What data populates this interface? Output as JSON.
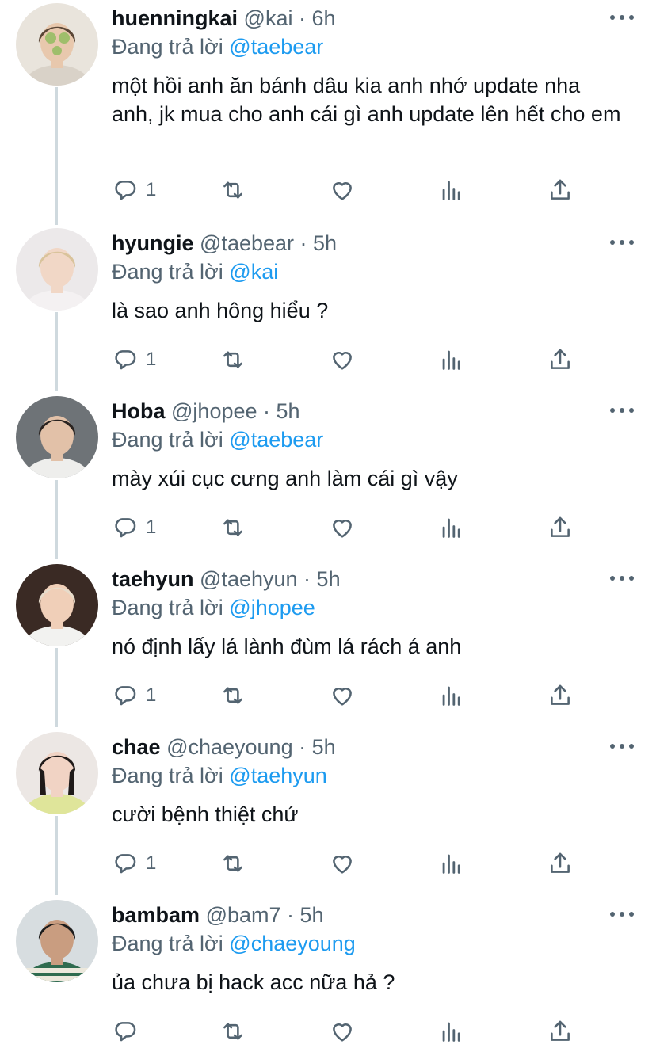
{
  "thread": {
    "tweets": [
      {
        "name": "huenningkai",
        "handle": "@kai",
        "time": "6h",
        "reply_prefix": "Đang trả lời",
        "reply_to": "@taebear",
        "text": "một hồi anh ăn bánh dâu kia anh nhớ update nha anh, jk mua cho anh cái gì anh update lên hết cho em",
        "reply_count": "1",
        "avatar_colors": {
          "bg": "#e9e4dc",
          "hair": "#5a4636",
          "skin": "#e8c8ad",
          "shirt": "#d9d2c8",
          "accent": "#9fbe6b"
        }
      },
      {
        "name": "hyungie",
        "handle": "@taebear",
        "time": "5h",
        "reply_prefix": "Đang trả lời",
        "reply_to": "@kai",
        "text": "là sao anh hông hiểu ?",
        "reply_count": "1",
        "avatar_colors": {
          "bg": "#ece9ea",
          "hair": "#d9c39b",
          "skin": "#f1d7c6",
          "shirt": "#f4f1f2",
          "accent": "#b9c4e0"
        }
      },
      {
        "name": "Hoba",
        "handle": "@jhopee",
        "time": "5h",
        "reply_prefix": "Đang trả lời",
        "reply_to": "@taebear",
        "text": "mày xúi cục cưng anh làm cái gì vậy",
        "reply_count": "1",
        "avatar_colors": {
          "bg": "#6e7377",
          "hair": "#2a2421",
          "skin": "#e2c1a8",
          "shirt": "#eeeeec",
          "accent": "#4a4f52"
        }
      },
      {
        "name": "taehyun",
        "handle": "@taehyun",
        "time": "5h",
        "reply_prefix": "Đang trả lời",
        "reply_to": "@jhopee",
        "text": "nó định lấy lá lành đùm lá rách á anh",
        "reply_count": "1",
        "avatar_colors": {
          "bg": "#3a2a24",
          "hair": "#e7dccb",
          "skin": "#f0cfb8",
          "shirt": "#f2f2f0",
          "accent": "#7a5a48"
        }
      },
      {
        "name": "chae",
        "handle": "@chaeyoung",
        "time": "5h",
        "reply_prefix": "Đang trả lời",
        "reply_to": "@taehyun",
        "text": "cười bệnh thiệt chứ",
        "reply_count": "1",
        "avatar_colors": {
          "bg": "#ece7e4",
          "hair": "#1f1a19",
          "skin": "#f1d3c4",
          "shirt": "#dfe59a",
          "accent": "#f6f4ef"
        }
      },
      {
        "name": "bambam",
        "handle": "@bam7",
        "time": "5h",
        "reply_prefix": "Đang trả lời",
        "reply_to": "@chaeyoung",
        "text": "ủa chưa bị hack acc nữa hả ?",
        "reply_count": "",
        "avatar_colors": {
          "bg": "#d7dde0",
          "hair": "#1c1c1c",
          "skin": "#c99d80",
          "shirt": "#2f6b4f",
          "accent": "#ece8dc"
        }
      }
    ]
  },
  "colors": {
    "text_primary": "#0f1419",
    "text_secondary": "#536471",
    "link": "#1d9bf0",
    "thread_line": "#cfd9de"
  },
  "icons": {
    "reply": "reply-icon",
    "retweet": "retweet-icon",
    "like": "heart-icon",
    "views": "analytics-icon",
    "share": "share-icon",
    "more": "more-options-icon"
  }
}
